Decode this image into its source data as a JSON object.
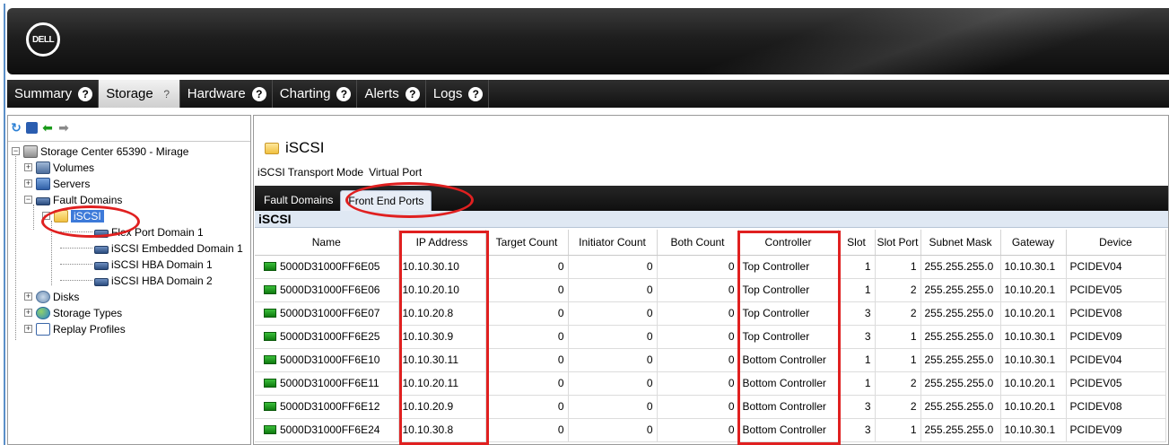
{
  "header": {
    "logo_text": "DELL"
  },
  "tabs": [
    {
      "label": "Summary",
      "help": "?"
    },
    {
      "label": "Storage",
      "help": "?",
      "active": true
    },
    {
      "label": "Hardware",
      "help": "?"
    },
    {
      "label": "Charting",
      "help": "?"
    },
    {
      "label": "Alerts",
      "help": "?"
    },
    {
      "label": "Logs",
      "help": "?"
    }
  ],
  "toolbar": {
    "refresh_icon": "refresh-icon",
    "save_icon": "save-icon",
    "back_icon": "back-arrow-icon",
    "forward_icon": "forward-arrow-icon"
  },
  "tree": {
    "storage_center": "Storage Center 65390 - Mirage",
    "volumes": "Volumes",
    "servers": "Servers",
    "fault_domains": "Fault Domains",
    "iscsi": "iSCSI",
    "flex_port_domain": "Flex Port Domain 1",
    "iscsi_embedded": "iSCSI Embedded Domain 1",
    "iscsi_hba_1": "iSCSI HBA Domain 1",
    "iscsi_hba_2": "iSCSI HBA Domain 2",
    "disks": "Disks",
    "storage_types": "Storage Types",
    "replay_profiles": "Replay Profiles",
    "expand_symbol": "+",
    "collapse_symbol": "−"
  },
  "main": {
    "title": "iSCSI",
    "transport_label": "iSCSI Transport Mode",
    "transport_value": "Virtual Port",
    "subtabs": [
      "Fault Domains",
      "Front End Ports"
    ],
    "section_title": "iSCSI",
    "columns": [
      "Name",
      "IP Address",
      "Target Count",
      "Initiator Count",
      "Both Count",
      "Controller",
      "Slot",
      "Slot Port",
      "Subnet Mask",
      "Gateway",
      "Device"
    ],
    "rows": [
      [
        "5000D31000FF6E05",
        "10.10.30.10",
        "0",
        "0",
        "0",
        "Top Controller",
        "1",
        "1",
        "255.255.255.0",
        "10.10.30.1",
        "PCIDEV04"
      ],
      [
        "5000D31000FF6E06",
        "10.10.20.10",
        "0",
        "0",
        "0",
        "Top Controller",
        "1",
        "2",
        "255.255.255.0",
        "10.10.20.1",
        "PCIDEV05"
      ],
      [
        "5000D31000FF6E07",
        "10.10.20.8",
        "0",
        "0",
        "0",
        "Top Controller",
        "3",
        "2",
        "255.255.255.0",
        "10.10.20.1",
        "PCIDEV08"
      ],
      [
        "5000D31000FF6E25",
        "10.10.30.9",
        "0",
        "0",
        "0",
        "Top Controller",
        "3",
        "1",
        "255.255.255.0",
        "10.10.30.1",
        "PCIDEV09"
      ],
      [
        "5000D31000FF6E10",
        "10.10.30.11",
        "0",
        "0",
        "0",
        "Bottom Controller",
        "1",
        "1",
        "255.255.255.0",
        "10.10.30.1",
        "PCIDEV04"
      ],
      [
        "5000D31000FF6E11",
        "10.10.20.11",
        "0",
        "0",
        "0",
        "Bottom Controller",
        "1",
        "2",
        "255.255.255.0",
        "10.10.20.1",
        "PCIDEV05"
      ],
      [
        "5000D31000FF6E12",
        "10.10.20.9",
        "0",
        "0",
        "0",
        "Bottom Controller",
        "3",
        "2",
        "255.255.255.0",
        "10.10.20.1",
        "PCIDEV08"
      ],
      [
        "5000D31000FF6E24",
        "10.10.30.8",
        "0",
        "0",
        "0",
        "Bottom Controller",
        "3",
        "1",
        "255.255.255.0",
        "10.10.30.1",
        "PCIDEV09"
      ]
    ]
  },
  "colors": {
    "annotation_red": "#e02020",
    "selection_blue": "#3d7ad9",
    "header_dark": "#1e1e1e"
  }
}
